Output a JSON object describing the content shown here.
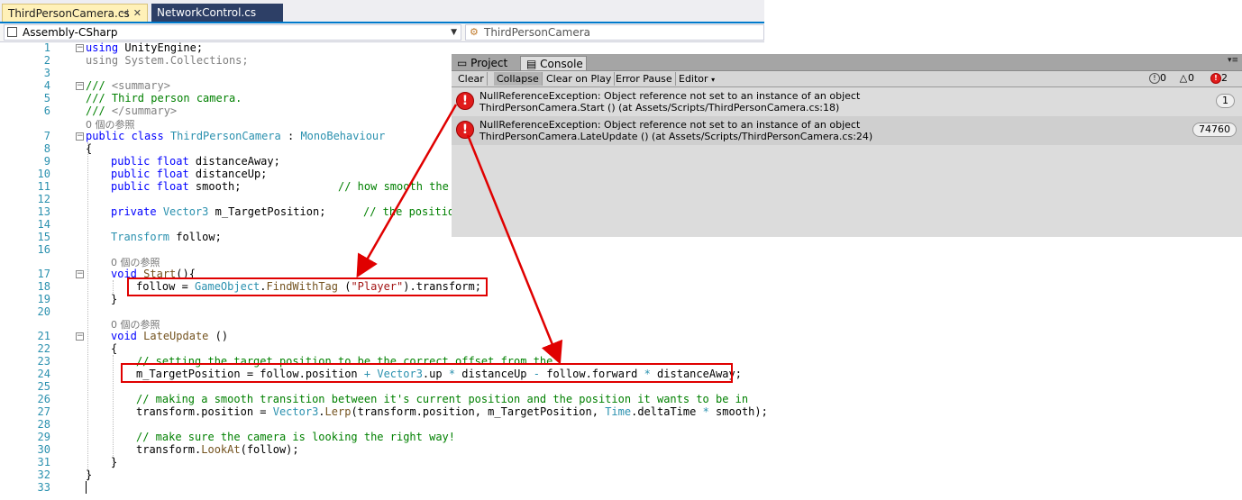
{
  "editor": {
    "tabs": [
      {
        "label": "ThirdPersonCamera.cs"
      },
      {
        "label": "NetworkControl.cs"
      }
    ],
    "nav": {
      "project": "Assembly-CSharp",
      "class": "ThirdPersonCamera"
    },
    "line_numbers": [
      "1",
      "2",
      "3",
      "4",
      "5",
      "6",
      "7",
      "8",
      "9",
      "10",
      "11",
      "12",
      "13",
      "14",
      "15",
      "16",
      "17",
      "18",
      "19",
      "20",
      "21",
      "22",
      "23",
      "24",
      "25",
      "26",
      "27",
      "28",
      "29",
      "30",
      "31",
      "32",
      "33"
    ],
    "hints": {
      "class_refs": "0 個の参照",
      "start_refs": "0 個の参照",
      "lateupdate_refs": "0 個の参照"
    },
    "code": {
      "l1a": "using",
      "l1b": " UnityEngine;",
      "l2a": "using",
      "l2b": " System.Collections;",
      "l4a": "/// ",
      "l4b": "<summary>",
      "l5": "/// Third person camera.",
      "l6a": "/// ",
      "l6b": "</summary>",
      "l7a": "public class",
      "l7b": "ThirdPersonCamera",
      "l7c": " : ",
      "l7d": "MonoBehaviour",
      "l8": "{",
      "l9a": "public float",
      "l9b": " distanceAway;",
      "l10a": "public float",
      "l10b": " distanceUp;",
      "l11a": "public float",
      "l11b": " smooth;",
      "l11c": "// how smooth the",
      "l13a": "private",
      "l13b": "Vector3",
      "l13c": " m_TargetPosition;",
      "l13d": "// the positio",
      "l15a": "Transform",
      "l15b": " follow;",
      "l17a": "void",
      "l17b": "Start",
      "l17c": "(){",
      "l18a": "follow = ",
      "l18b": "GameObject",
      "l18c": ".",
      "l18d": "FindWithTag",
      "l18e": " (",
      "l18f": "\"Player\"",
      "l18g": ").transform;",
      "l19": "}",
      "l21a": "void",
      "l21b": "LateUpdate",
      "l21c": " ()",
      "l22": "{",
      "l23": "// setting the target position to be the correct offset from the",
      "l24a": "m_TargetPosition = follow.position ",
      "l24b": "+",
      "l24c": "Vector3",
      "l24d": ".up ",
      "l24e": "*",
      "l24f": " distanceUp ",
      "l24g": "-",
      "l24h": " follow.forward ",
      "l24i": "*",
      "l24j": " distanceAway;",
      "l26": "// making a smooth transition between it's current position and the position it wants to be in",
      "l27a": "transform.position = ",
      "l27b": "Vector3",
      "l27c": ".",
      "l27d": "Lerp",
      "l27e": "(transform.position, m_TargetPosition, ",
      "l27f": "Time",
      "l27g": ".deltaTime ",
      "l27h": "*",
      "l27i": " smooth);",
      "l29": "// make sure the camera is looking the right way!",
      "l30a": "transform.",
      "l30b": "LookAt",
      "l30c": "(follow);",
      "l31": "}",
      "l32": "}"
    }
  },
  "console": {
    "tabs": {
      "project": "Project",
      "console": "Console"
    },
    "toolbar": {
      "clear": "Clear",
      "collapse": "Collapse",
      "clear_on_play": "Clear on Play",
      "error_pause": "Error Pause",
      "editor": "Editor"
    },
    "counts": {
      "info": "0",
      "warn": "0",
      "error": "2"
    },
    "entries": [
      {
        "line1": "NullReferenceException: Object reference not set to an instance of an object",
        "line2": "ThirdPersonCamera.Start () (at Assets/Scripts/ThirdPersonCamera.cs:18)",
        "count": "1"
      },
      {
        "line1": "NullReferenceException: Object reference not set to an instance of an object",
        "line2": "ThirdPersonCamera.LateUpdate () (at Assets/Scripts/ThirdPersonCamera.cs:24)",
        "count": "74760"
      }
    ]
  },
  "colors": {
    "keyword": "#0000ff",
    "type": "#2b91af",
    "comment": "#008000",
    "string": "#a31515",
    "error_red": "#e00000"
  }
}
